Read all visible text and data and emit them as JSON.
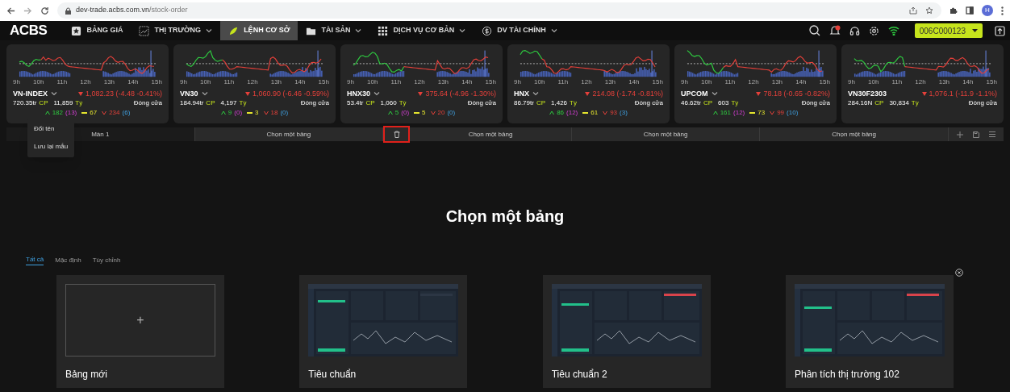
{
  "browser": {
    "url_host": "dev-trade.acbs.com.vn",
    "url_path": "/stock-order",
    "profile_initial": "H"
  },
  "nav": {
    "logo": "ACBS",
    "items": [
      {
        "label": "BẢNG GIÁ",
        "dropdown": false,
        "selected": false
      },
      {
        "label": "THỊ TRƯỜNG",
        "dropdown": true,
        "selected": false
      },
      {
        "label": "LỆNH CƠ SỞ",
        "dropdown": false,
        "selected": true
      },
      {
        "label": "TÀI SẢN",
        "dropdown": true,
        "selected": false
      },
      {
        "label": "DỊCH VỤ CƠ BẢN",
        "dropdown": true,
        "selected": false
      },
      {
        "label": "DV TÀI CHÍNH",
        "dropdown": true,
        "selected": false
      }
    ],
    "account": "006C000123"
  },
  "indices": [
    {
      "name": "VN-INDEX",
      "dropdown": true,
      "change": "1,082.23 (-4.48 -0.41%)",
      "volume": "720.35tr",
      "volume_unit": "CP",
      "value": "11,859",
      "value_unit": "Tỷ",
      "status": "Đóng cửa",
      "hours": [
        "9h",
        "10h",
        "11h",
        "12h",
        "13h",
        "14h",
        "15h"
      ],
      "breadth": {
        "up": "182",
        "up_ceiling": "(13)",
        "flat": "67",
        "down": "234",
        "down_floor": "(6)"
      }
    },
    {
      "name": "VN30",
      "dropdown": true,
      "change": "1,060.90 (-6.46 -0.59%)",
      "volume": "184.94tr",
      "volume_unit": "CP",
      "value": "4,197",
      "value_unit": "Tỷ",
      "status": "Đóng cửa",
      "hours": [
        "9h",
        "10h",
        "11h",
        "12h",
        "13h",
        "14h",
        "15h"
      ],
      "breadth": {
        "up": "9",
        "up_ceiling": "(0)",
        "flat": "3",
        "down": "18",
        "down_floor": "(0)"
      }
    },
    {
      "name": "HNX30",
      "dropdown": true,
      "change": "375.64 (-4.96 -1.30%)",
      "volume": "53.4tr",
      "volume_unit": "CP",
      "value": "1,060",
      "value_unit": "Tỷ",
      "status": "Đóng cửa",
      "hours": [
        "9h",
        "10h",
        "11h",
        "12h",
        "13h",
        "14h",
        "15h"
      ],
      "breadth": {
        "up": "5",
        "up_ceiling": "(0)",
        "flat": "5",
        "down": "20",
        "down_floor": "(0)"
      }
    },
    {
      "name": "HNX",
      "dropdown": true,
      "change": "214.08 (-1.74 -0.81%)",
      "volume": "86.79tr",
      "volume_unit": "CP",
      "value": "1,426",
      "value_unit": "Tỷ",
      "status": "Đóng cửa",
      "hours": [
        "9h",
        "10h",
        "11h",
        "12h",
        "13h",
        "14h",
        "15h"
      ],
      "breadth": {
        "up": "86",
        "up_ceiling": "(12)",
        "flat": "61",
        "down": "93",
        "down_floor": "(3)"
      }
    },
    {
      "name": "UPCOM",
      "dropdown": true,
      "change": "78.18 (-0.65 -0.82%)",
      "volume": "46.62tr",
      "volume_unit": "CP",
      "value": "603",
      "value_unit": "Tỷ",
      "status": "Đóng cửa",
      "hours": [
        "9h",
        "10h",
        "11h",
        "12h",
        "13h",
        "14h",
        "15h"
      ],
      "breadth": {
        "up": "161",
        "up_ceiling": "(12)",
        "flat": "73",
        "down": "99",
        "down_floor": "(10)"
      }
    },
    {
      "name": "VN30F2303",
      "dropdown": false,
      "change": "1,076.1 (-11.9 -1.1%)",
      "volume": "284.16N",
      "volume_unit": "CP",
      "value": "30,834",
      "value_unit": "Tỷ",
      "status": "Đóng cửa",
      "hours": [
        "9h",
        "10h",
        "11h",
        "12h",
        "13h",
        "14h",
        "15h"
      ]
    }
  ],
  "screen_tabs": [
    {
      "label": "Màn 1",
      "selected": true,
      "delete_icon": false
    },
    {
      "label": "Chọn một bảng",
      "selected": false,
      "delete_icon": false
    },
    {
      "label": "Chọn một bảng",
      "selected": false,
      "delete_icon": true
    },
    {
      "label": "Chọn một bảng",
      "selected": false,
      "delete_icon": false
    },
    {
      "label": "Chọn một bảng",
      "selected": false,
      "delete_icon": false
    }
  ],
  "context_menu": [
    "Đổi tên",
    "Lưu lại mẫu"
  ],
  "main": {
    "title": "Chọn một bảng",
    "filters": [
      {
        "label": "Tất cả",
        "selected": true
      },
      {
        "label": "Mặc định",
        "selected": false
      },
      {
        "label": "Tùy chỉnh",
        "selected": false
      }
    ],
    "templates": [
      {
        "kind": "new",
        "symbol": "+",
        "title": "Bảng mới",
        "closable": false
      },
      {
        "kind": "template",
        "title": "Tiêu chuẩn",
        "closable": false
      },
      {
        "kind": "template",
        "title": "Tiêu chuẩn 2",
        "closable": false
      },
      {
        "kind": "template",
        "title": "Phân tích thị trường 102",
        "closable": true
      }
    ]
  }
}
